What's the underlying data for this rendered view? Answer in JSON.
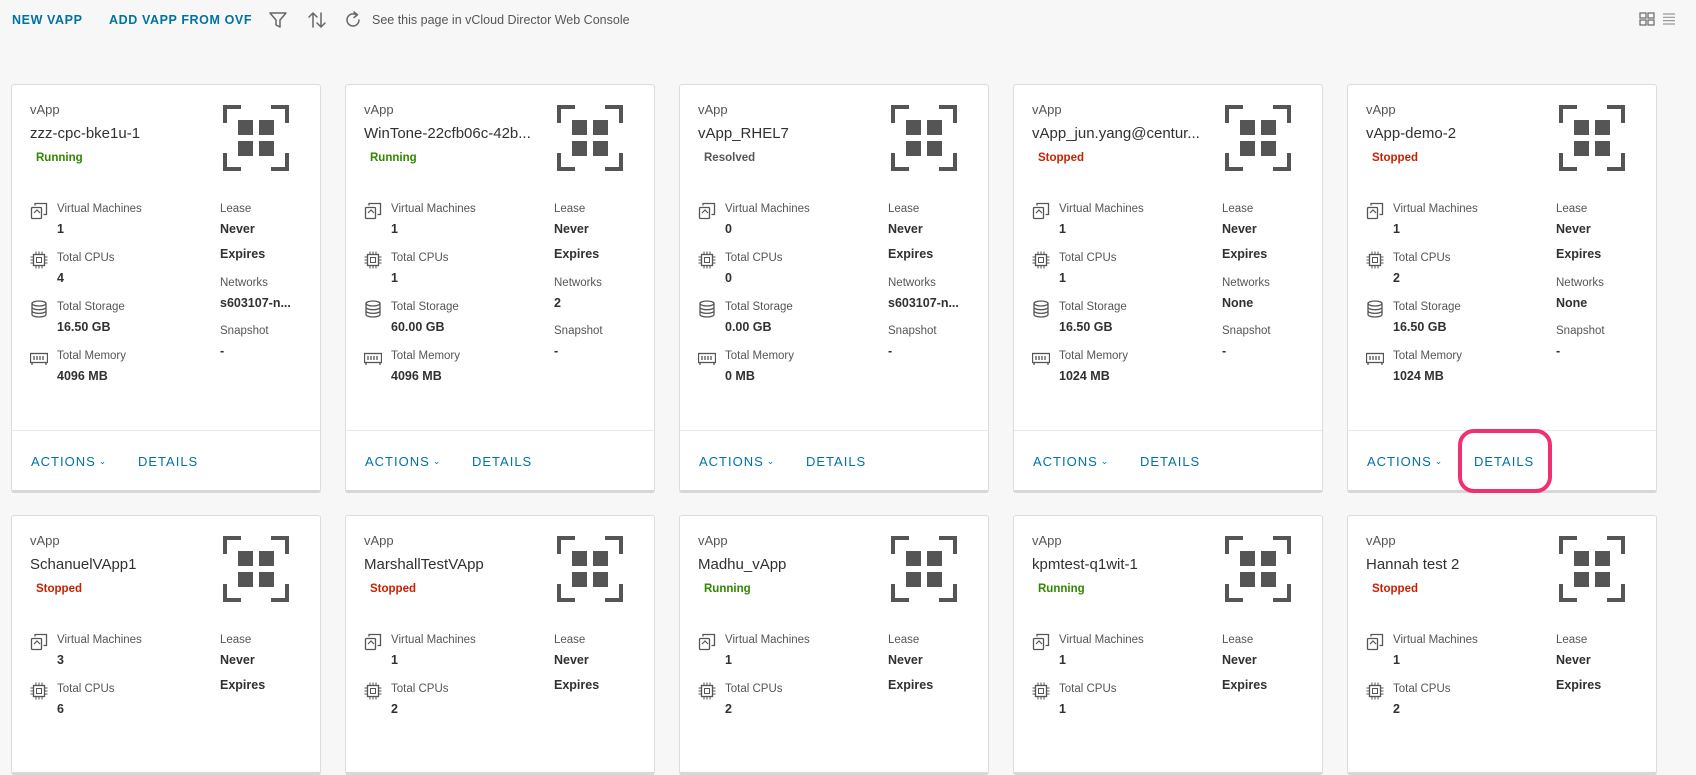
{
  "toolbar": {
    "new_vapp": "NEW VAPP",
    "add_from_ovf": "ADD VAPP FROM OVF",
    "console_link": "See this page in vCloud Director Web Console",
    "filter_icon": "filter-icon",
    "sort_icon": "sort-icon",
    "refresh_icon": "refresh-icon",
    "grid_view_icon": "grid-view-icon",
    "list_view_icon": "list-view-icon"
  },
  "labels": {
    "type": "vApp",
    "vms": "Virtual Machines",
    "cpus": "Total CPUs",
    "storage": "Total Storage",
    "memory": "Total Memory",
    "lease": "Lease",
    "networks": "Networks",
    "snapshot": "Snapshot",
    "actions": "ACTIONS",
    "details": "DETAILS"
  },
  "colors": {
    "accent": "#0072a3",
    "running": "#318700",
    "stopped": "#c92100",
    "highlight": "#f0306f"
  },
  "cards": [
    {
      "name": "zzz-cpc-bke1u-1",
      "status": "Running",
      "vms": "1",
      "cpus": "4",
      "storage": "16.50 GB",
      "memory": "4096 MB",
      "lease1": "Never",
      "lease2": "Expires",
      "networks": "s603107-n...",
      "snapshot": "-"
    },
    {
      "name": "WinTone-22cfb06c-42b...",
      "status": "Running",
      "vms": "1",
      "cpus": "1",
      "storage": "60.00 GB",
      "memory": "4096 MB",
      "lease1": "Never",
      "lease2": "Expires",
      "networks": "2",
      "snapshot": "-"
    },
    {
      "name": "vApp_RHEL7",
      "status": "Resolved",
      "vms": "0",
      "cpus": "0",
      "storage": "0.00 GB",
      "memory": "0 MB",
      "lease1": "Never",
      "lease2": "Expires",
      "networks": "s603107-n...",
      "snapshot": "-"
    },
    {
      "name": "vApp_jun.yang@centur...",
      "status": "Stopped",
      "vms": "1",
      "cpus": "1",
      "storage": "16.50 GB",
      "memory": "1024 MB",
      "lease1": "Never",
      "lease2": "Expires",
      "networks": "None",
      "snapshot": "-"
    },
    {
      "name": "vApp-demo-2",
      "status": "Stopped",
      "vms": "1",
      "cpus": "2",
      "storage": "16.50 GB",
      "memory": "1024 MB",
      "lease1": "Never",
      "lease2": "Expires",
      "networks": "None",
      "snapshot": "-"
    },
    {
      "name": "SchanuelVApp1",
      "status": "Stopped",
      "vms": "3",
      "cpus": "6",
      "lease1": "Never",
      "lease2": "Expires"
    },
    {
      "name": "MarshallTestVApp",
      "status": "Stopped",
      "vms": "1",
      "cpus": "2",
      "lease1": "Never",
      "lease2": "Expires"
    },
    {
      "name": "Madhu_vApp",
      "status": "Running",
      "vms": "1",
      "cpus": "2",
      "lease1": "Never",
      "lease2": "Expires"
    },
    {
      "name": "kpmtest-q1wit-1",
      "status": "Running",
      "vms": "1",
      "cpus": "1",
      "lease1": "Never",
      "lease2": "Expires"
    },
    {
      "name": "Hannah test 2",
      "status": "Stopped",
      "vms": "1",
      "cpus": "2",
      "lease1": "Never",
      "lease2": "Expires"
    }
  ]
}
